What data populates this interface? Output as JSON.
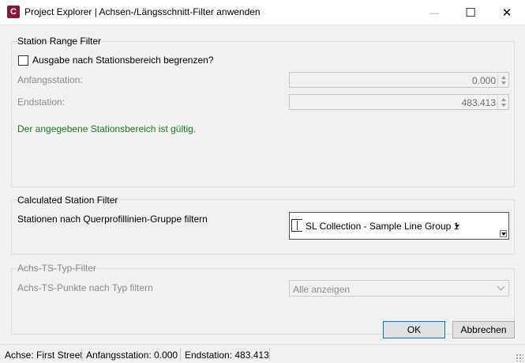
{
  "window": {
    "title": "Project Explorer | Achsen-/Längsschnitt-Filter anwenden",
    "app_icon_letter": "C",
    "minimize_glyph": "—",
    "maximize_glyph": "☐",
    "close_glyph": "✕"
  },
  "station_range": {
    "group_title": "Station Range Filter",
    "limit_checkbox_label": "Ausgabe nach Stationsbereich begrenzen?",
    "limit_checked": false,
    "start_label": "Anfangsstation:",
    "start_value": "0.000",
    "end_label": "Endstation:",
    "end_value": "483.413",
    "valid_message": "Der angegebene Stationsbereich ist gültig."
  },
  "calculated": {
    "group_title": "Calculated Station Filter",
    "filter_label": "Stationen nach Querprofillinien-Gruppe filtern",
    "selected_group": "SL Collection - Sample Line Group 1"
  },
  "achs_ts": {
    "group_title": "Achs-TS-Typ-Filter",
    "filter_label": "Achs-TS-Punkte nach Typ filtern",
    "selected": "Alle anzeigen"
  },
  "buttons": {
    "ok": "OK",
    "cancel": "Abbrechen"
  },
  "status": {
    "alignment": "Achse: First Street",
    "start": "Anfangsstation: 0.000",
    "end": "Endstation: 483.413"
  },
  "colors": {
    "valid_text": "#1a7f1a",
    "app_icon": "#8a1538",
    "default_button_border": "#0078d7"
  }
}
